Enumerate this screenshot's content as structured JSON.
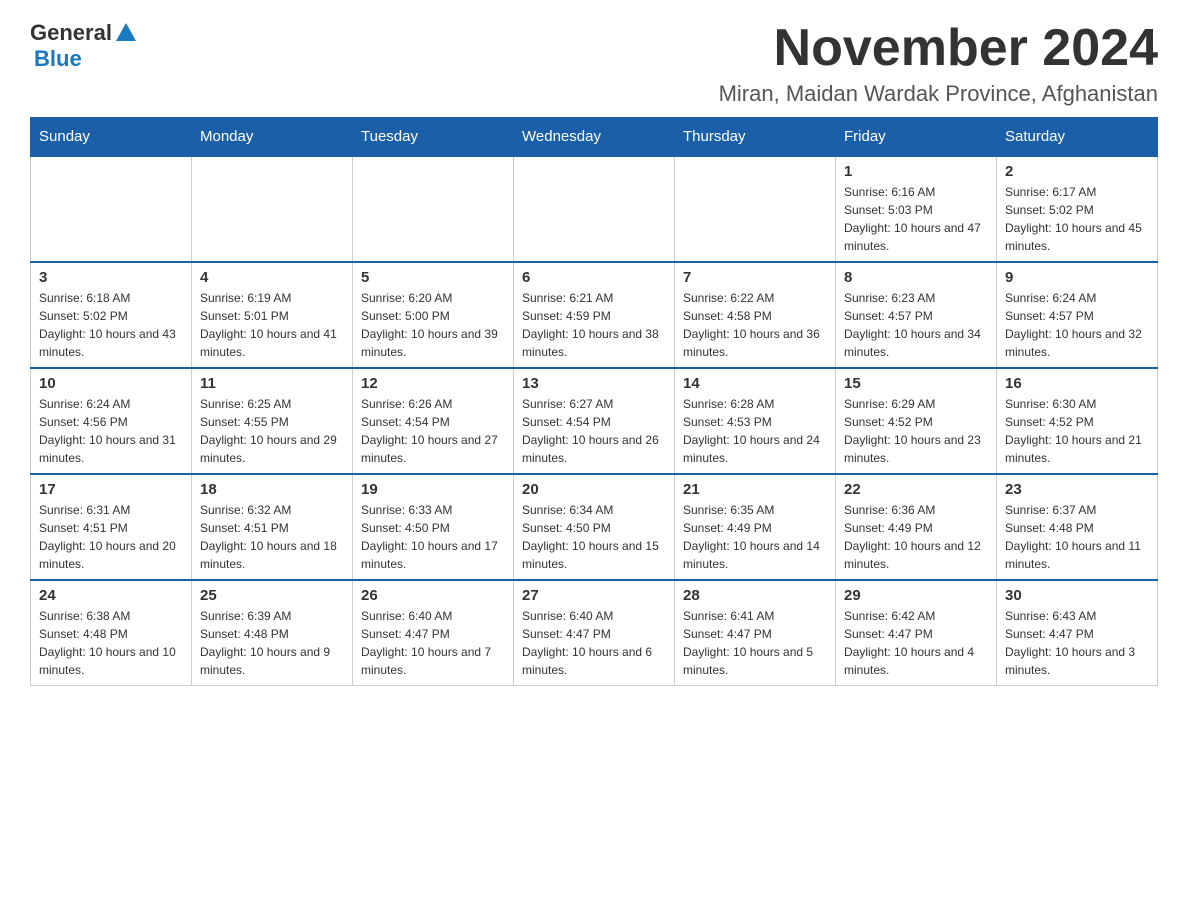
{
  "header": {
    "logo_general": "General",
    "logo_blue": "Blue",
    "month_title": "November 2024",
    "location": "Miran, Maidan Wardak Province, Afghanistan"
  },
  "weekdays": [
    "Sunday",
    "Monday",
    "Tuesday",
    "Wednesday",
    "Thursday",
    "Friday",
    "Saturday"
  ],
  "weeks": [
    [
      {
        "day": "",
        "info": ""
      },
      {
        "day": "",
        "info": ""
      },
      {
        "day": "",
        "info": ""
      },
      {
        "day": "",
        "info": ""
      },
      {
        "day": "",
        "info": ""
      },
      {
        "day": "1",
        "info": "Sunrise: 6:16 AM\nSunset: 5:03 PM\nDaylight: 10 hours and 47 minutes."
      },
      {
        "day": "2",
        "info": "Sunrise: 6:17 AM\nSunset: 5:02 PM\nDaylight: 10 hours and 45 minutes."
      }
    ],
    [
      {
        "day": "3",
        "info": "Sunrise: 6:18 AM\nSunset: 5:02 PM\nDaylight: 10 hours and 43 minutes."
      },
      {
        "day": "4",
        "info": "Sunrise: 6:19 AM\nSunset: 5:01 PM\nDaylight: 10 hours and 41 minutes."
      },
      {
        "day": "5",
        "info": "Sunrise: 6:20 AM\nSunset: 5:00 PM\nDaylight: 10 hours and 39 minutes."
      },
      {
        "day": "6",
        "info": "Sunrise: 6:21 AM\nSunset: 4:59 PM\nDaylight: 10 hours and 38 minutes."
      },
      {
        "day": "7",
        "info": "Sunrise: 6:22 AM\nSunset: 4:58 PM\nDaylight: 10 hours and 36 minutes."
      },
      {
        "day": "8",
        "info": "Sunrise: 6:23 AM\nSunset: 4:57 PM\nDaylight: 10 hours and 34 minutes."
      },
      {
        "day": "9",
        "info": "Sunrise: 6:24 AM\nSunset: 4:57 PM\nDaylight: 10 hours and 32 minutes."
      }
    ],
    [
      {
        "day": "10",
        "info": "Sunrise: 6:24 AM\nSunset: 4:56 PM\nDaylight: 10 hours and 31 minutes."
      },
      {
        "day": "11",
        "info": "Sunrise: 6:25 AM\nSunset: 4:55 PM\nDaylight: 10 hours and 29 minutes."
      },
      {
        "day": "12",
        "info": "Sunrise: 6:26 AM\nSunset: 4:54 PM\nDaylight: 10 hours and 27 minutes."
      },
      {
        "day": "13",
        "info": "Sunrise: 6:27 AM\nSunset: 4:54 PM\nDaylight: 10 hours and 26 minutes."
      },
      {
        "day": "14",
        "info": "Sunrise: 6:28 AM\nSunset: 4:53 PM\nDaylight: 10 hours and 24 minutes."
      },
      {
        "day": "15",
        "info": "Sunrise: 6:29 AM\nSunset: 4:52 PM\nDaylight: 10 hours and 23 minutes."
      },
      {
        "day": "16",
        "info": "Sunrise: 6:30 AM\nSunset: 4:52 PM\nDaylight: 10 hours and 21 minutes."
      }
    ],
    [
      {
        "day": "17",
        "info": "Sunrise: 6:31 AM\nSunset: 4:51 PM\nDaylight: 10 hours and 20 minutes."
      },
      {
        "day": "18",
        "info": "Sunrise: 6:32 AM\nSunset: 4:51 PM\nDaylight: 10 hours and 18 minutes."
      },
      {
        "day": "19",
        "info": "Sunrise: 6:33 AM\nSunset: 4:50 PM\nDaylight: 10 hours and 17 minutes."
      },
      {
        "day": "20",
        "info": "Sunrise: 6:34 AM\nSunset: 4:50 PM\nDaylight: 10 hours and 15 minutes."
      },
      {
        "day": "21",
        "info": "Sunrise: 6:35 AM\nSunset: 4:49 PM\nDaylight: 10 hours and 14 minutes."
      },
      {
        "day": "22",
        "info": "Sunrise: 6:36 AM\nSunset: 4:49 PM\nDaylight: 10 hours and 12 minutes."
      },
      {
        "day": "23",
        "info": "Sunrise: 6:37 AM\nSunset: 4:48 PM\nDaylight: 10 hours and 11 minutes."
      }
    ],
    [
      {
        "day": "24",
        "info": "Sunrise: 6:38 AM\nSunset: 4:48 PM\nDaylight: 10 hours and 10 minutes."
      },
      {
        "day": "25",
        "info": "Sunrise: 6:39 AM\nSunset: 4:48 PM\nDaylight: 10 hours and 9 minutes."
      },
      {
        "day": "26",
        "info": "Sunrise: 6:40 AM\nSunset: 4:47 PM\nDaylight: 10 hours and 7 minutes."
      },
      {
        "day": "27",
        "info": "Sunrise: 6:40 AM\nSunset: 4:47 PM\nDaylight: 10 hours and 6 minutes."
      },
      {
        "day": "28",
        "info": "Sunrise: 6:41 AM\nSunset: 4:47 PM\nDaylight: 10 hours and 5 minutes."
      },
      {
        "day": "29",
        "info": "Sunrise: 6:42 AM\nSunset: 4:47 PM\nDaylight: 10 hours and 4 minutes."
      },
      {
        "day": "30",
        "info": "Sunrise: 6:43 AM\nSunset: 4:47 PM\nDaylight: 10 hours and 3 minutes."
      }
    ]
  ]
}
